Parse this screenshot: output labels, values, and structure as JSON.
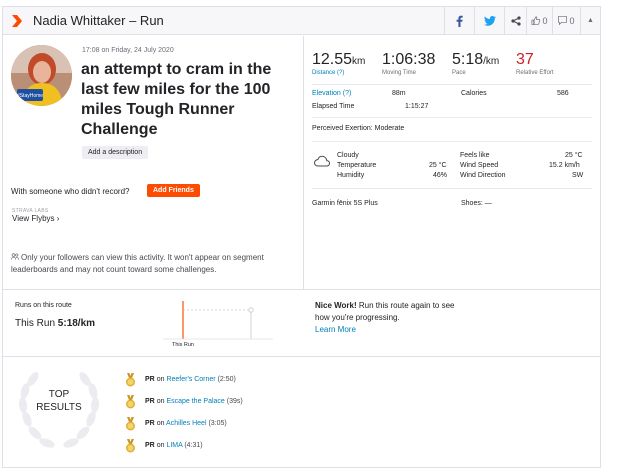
{
  "header": {
    "title": "Nadia Whittaker – Run",
    "kudos_count": "0",
    "comments_count": "0"
  },
  "activity": {
    "datetime": "17:08 on Friday, 24 July 2020",
    "name": "an attempt to cram in the last few miles for the 100 miles Tough Runner Challenge",
    "add_description_label": "Add a description",
    "avatar_caption": "#StayHome"
  },
  "social": {
    "with_someone_text": "With someone who didn't record?",
    "add_friends_label": "Add Friends",
    "labs_label": "STRAVA LABS",
    "view_flybys_label": "View Flybys"
  },
  "privacy_text": "Only your followers can view this activity. It won't appear on segment leaderboards and may not count toward some challenges.",
  "stats": {
    "distance": {
      "value": "12.55",
      "unit": "km",
      "label": "Distance (?)"
    },
    "moving_time": {
      "value": "1:06:38",
      "label": "Moving Time"
    },
    "pace": {
      "value": "5:18",
      "unit": "/km",
      "label": "Pace"
    },
    "relative_effort": {
      "value": "37",
      "label": "Relative Effort"
    },
    "elevation_label": "Elevation (?)",
    "elevation_value": "88m",
    "calories_label": "Calories",
    "calories_value": "586",
    "elapsed_label": "Elapsed Time",
    "elapsed_value": "1:15:27",
    "perceived_exertion": "Perceived Exertion: Moderate"
  },
  "weather": {
    "condition": "Cloudy",
    "temperature_label": "Temperature",
    "temperature_value": "25 °C",
    "humidity_label": "Humidity",
    "humidity_value": "46%",
    "feels_like_label": "Feels like",
    "feels_like_value": "25 °C",
    "wind_speed_label": "Wind Speed",
    "wind_speed_value": "15.2 km/h",
    "wind_direction_label": "Wind Direction",
    "wind_direction_value": "SW"
  },
  "gear": {
    "device": "Garmin fēnix 5S Plus",
    "shoes": "Shoes: —"
  },
  "route": {
    "label": "Runs on this route",
    "this_run_label": "This Run",
    "this_run_pace": "5:18/km",
    "chart_label": "This Run",
    "nice_work": "Nice Work!",
    "message": "Run this route again to see how you're progressing.",
    "learn_more": "Learn More"
  },
  "top_results": {
    "title_line1": "TOP",
    "title_line2": "RESULTS",
    "items": [
      {
        "badge": "PR",
        "on": "on",
        "segment": "Reefer's Corner",
        "time": "(2:50)"
      },
      {
        "badge": "PR",
        "on": "on",
        "segment": "Escape the Palace",
        "time": "(39s)"
      },
      {
        "badge": "PR",
        "on": "on",
        "segment": "Achilles Heel",
        "time": "(3:05)"
      },
      {
        "badge": "PR",
        "on": "on",
        "segment": "LIMA",
        "time": "(4:31)"
      }
    ]
  },
  "colors": {
    "brand": "#fc4c02",
    "link": "#007fb6",
    "relative_effort": "#cc1f2a",
    "medal": "#e0b032"
  }
}
